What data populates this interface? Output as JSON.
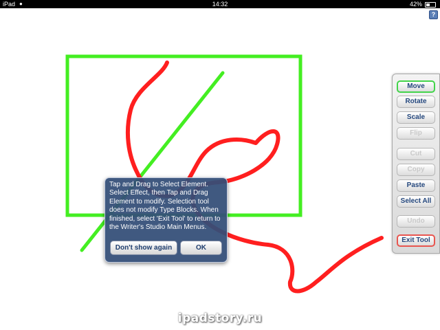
{
  "status_bar": {
    "carrier": "iPad",
    "time": "14:32",
    "battery": "42%"
  },
  "help_button": "?",
  "canvas": {
    "rectangle_color": "#44ee22",
    "line_color": "#44ee22",
    "scribble_color": "#ff1f1f"
  },
  "tool_panel": {
    "buttons": [
      {
        "label": "Move",
        "state": "active"
      },
      {
        "label": "Rotate",
        "state": "enabled"
      },
      {
        "label": "Scale",
        "state": "enabled"
      },
      {
        "label": "Flip",
        "state": "disabled"
      },
      {
        "label": "Cut",
        "state": "disabled"
      },
      {
        "label": "Copy",
        "state": "disabled"
      },
      {
        "label": "Paste",
        "state": "enabled"
      },
      {
        "label": "Select All",
        "state": "enabled"
      },
      {
        "label": "Undo",
        "state": "disabled"
      },
      {
        "label": "Exit Tool",
        "state": "exit"
      }
    ]
  },
  "dialog": {
    "message": "Tap and Drag to Select Element. Select Effect, then Tap and Drag Element to modify.  Selection tool does not modify Type Blocks. When finished, select 'Exit Tool' to return to the Writer's Studio Main Menus.",
    "dont_show_label": "Don't show again",
    "ok_label": "OK"
  },
  "watermark": "ipadstory.ru"
}
